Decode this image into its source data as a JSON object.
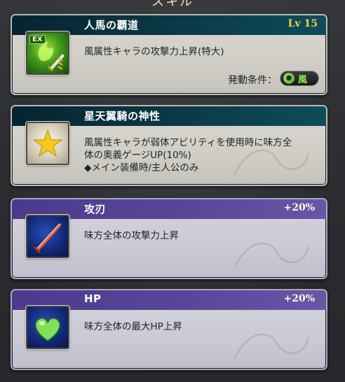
{
  "header": {
    "title": "スキル"
  },
  "skills": [
    {
      "title": "人馬の覇道",
      "level": "Lv 15",
      "desc": "風属性キャラの攻撃力上昇(特大)",
      "condition_label": "発動条件：",
      "condition_element": "風",
      "icon": "ex-wind-sword-icon",
      "icon_badge": "EX"
    },
    {
      "title": "星天翼騎の神性",
      "desc_lines": [
        "風属性キャラが弱体アビリティを使用時に味方全",
        "体の奥義ゲージUP(10%)",
        "◆メイン装備時/主人公のみ"
      ],
      "icon": "star-icon"
    },
    {
      "title": "攻刃",
      "bonus": "+20%",
      "desc": "味方全体の攻撃力上昇",
      "icon": "sword-icon"
    },
    {
      "title": "HP",
      "bonus": "+20%",
      "desc": "味方全体の最大HP上昇",
      "icon": "heart-icon"
    }
  ],
  "colors": {
    "gold_titlebar": "#0b3a48",
    "purple_titlebar": "#5a4697",
    "level_yellow": "#f2d33b",
    "wind_green": "#8ef052"
  }
}
